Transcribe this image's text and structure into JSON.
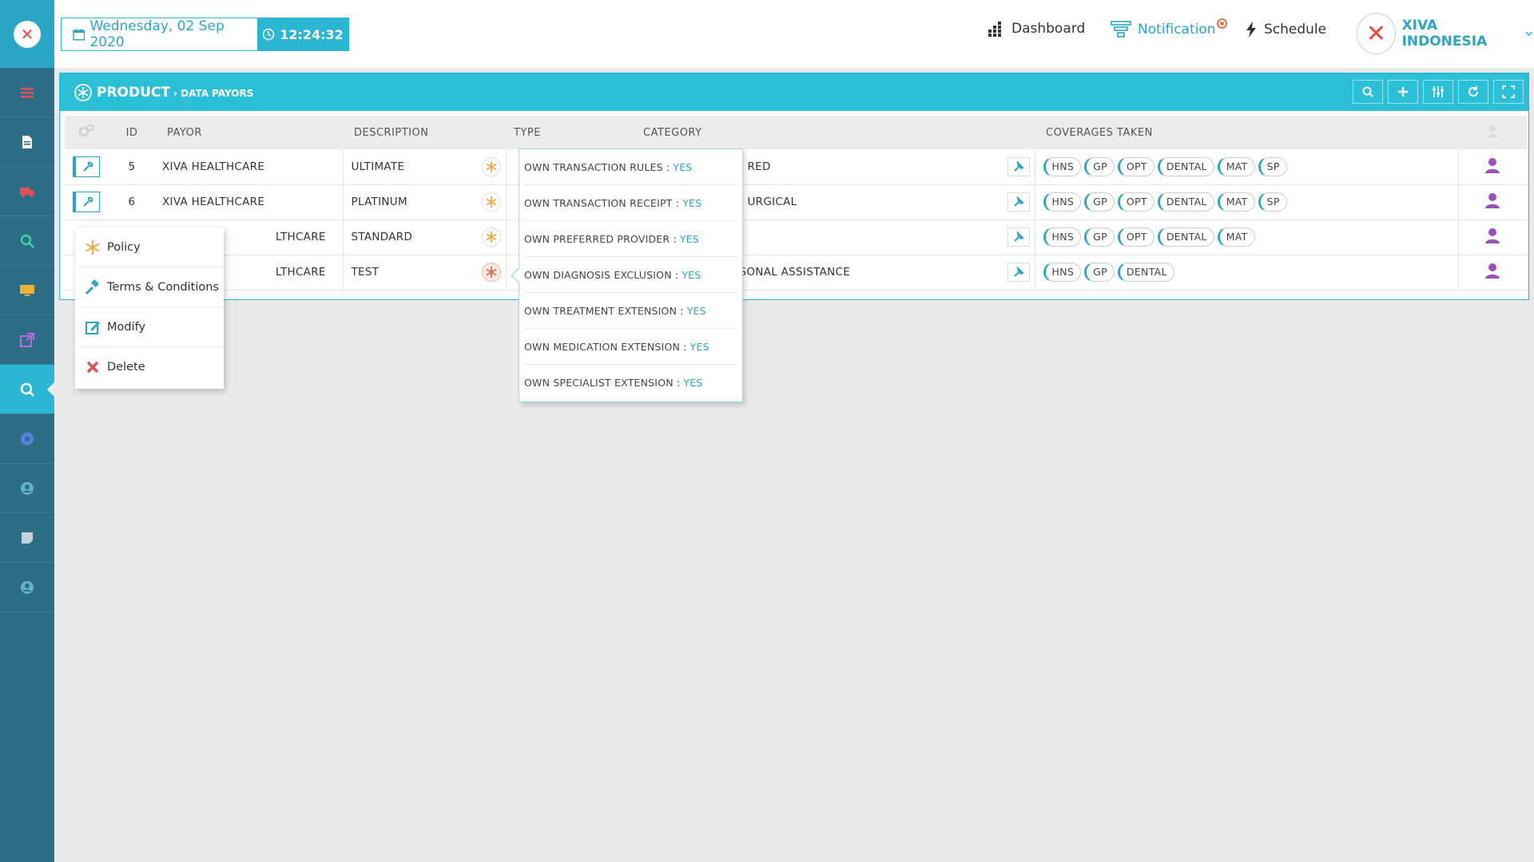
{
  "app": {
    "date": "Wednesday, 02 Sep 2020",
    "time": "12:24:32",
    "accent_color": "#2bc0d8",
    "sidebar_color": "#2c6e86"
  },
  "topnav": {
    "dashboard": "Dashboard",
    "notification": "Notification",
    "schedule": "Schedule",
    "company": "XIVA INDONESIA"
  },
  "sidebar": {
    "items": [
      {
        "icon": "menu-icon"
      },
      {
        "icon": "document-icon"
      },
      {
        "icon": "ambulance-icon"
      },
      {
        "icon": "search-icon"
      },
      {
        "icon": "monitor-icon"
      },
      {
        "icon": "external-link-icon"
      },
      {
        "icon": "refresh-search-icon",
        "active": true
      },
      {
        "icon": "globe-icon"
      },
      {
        "icon": "user-circle-icon"
      },
      {
        "icon": "note-icon"
      },
      {
        "icon": "user-circle-icon"
      }
    ]
  },
  "panel": {
    "title": "PRODUCT",
    "breadcrumb": "› DATA PAYORS",
    "columns": [
      "ID",
      "PAYOR",
      "DESCRIPTION",
      "TYPE",
      "CATEGORY",
      "COVERAGES TAKEN"
    ],
    "rows": [
      {
        "id": "5",
        "payor": "XIVA HEALTHCARE",
        "description": "ULTIMATE",
        "type": "",
        "category": "RED",
        "coverages": [
          "HNS",
          "GP",
          "OPT",
          "DENTAL",
          "MAT",
          "SP"
        ]
      },
      {
        "id": "6",
        "payor": "XIVA HEALTHCARE",
        "description": "PLATINUM",
        "type": "",
        "category": "URGICAL",
        "coverages": [
          "HNS",
          "GP",
          "OPT",
          "DENTAL",
          "MAT",
          "SP"
        ]
      },
      {
        "id": "",
        "payor": "LTHCARE",
        "description": "STANDARD",
        "type": "",
        "category": "",
        "coverages": [
          "HNS",
          "GP",
          "OPT",
          "DENTAL",
          "MAT"
        ]
      },
      {
        "id": "",
        "payor": "LTHCARE",
        "description": "TEST",
        "type": "",
        "category": "SONAL ASSISTANCE",
        "coverages": [
          "HNS",
          "GP",
          "DENTAL"
        ]
      }
    ]
  },
  "context_menu": {
    "policy": "Policy",
    "terms": "Terms & Conditions",
    "modify": "Modify",
    "delete": "Delete"
  },
  "popover": {
    "rows": [
      {
        "label": "OWN TRANSACTION RULES :",
        "value": "YES"
      },
      {
        "label": "OWN TRANSACTION RECEIPT :",
        "value": "YES"
      },
      {
        "label": "OWN PREFERRED PROVIDER :",
        "value": "YES"
      },
      {
        "label": "OWN DIAGNOSIS EXCLUSION :",
        "value": "YES"
      },
      {
        "label": "OWN TREATMENT EXTENSION :",
        "value": "YES"
      },
      {
        "label": "OWN MEDICATION EXTENSION :",
        "value": "YES"
      },
      {
        "label": "OWN SPECIALIST EXTENSION :",
        "value": "YES"
      }
    ]
  }
}
